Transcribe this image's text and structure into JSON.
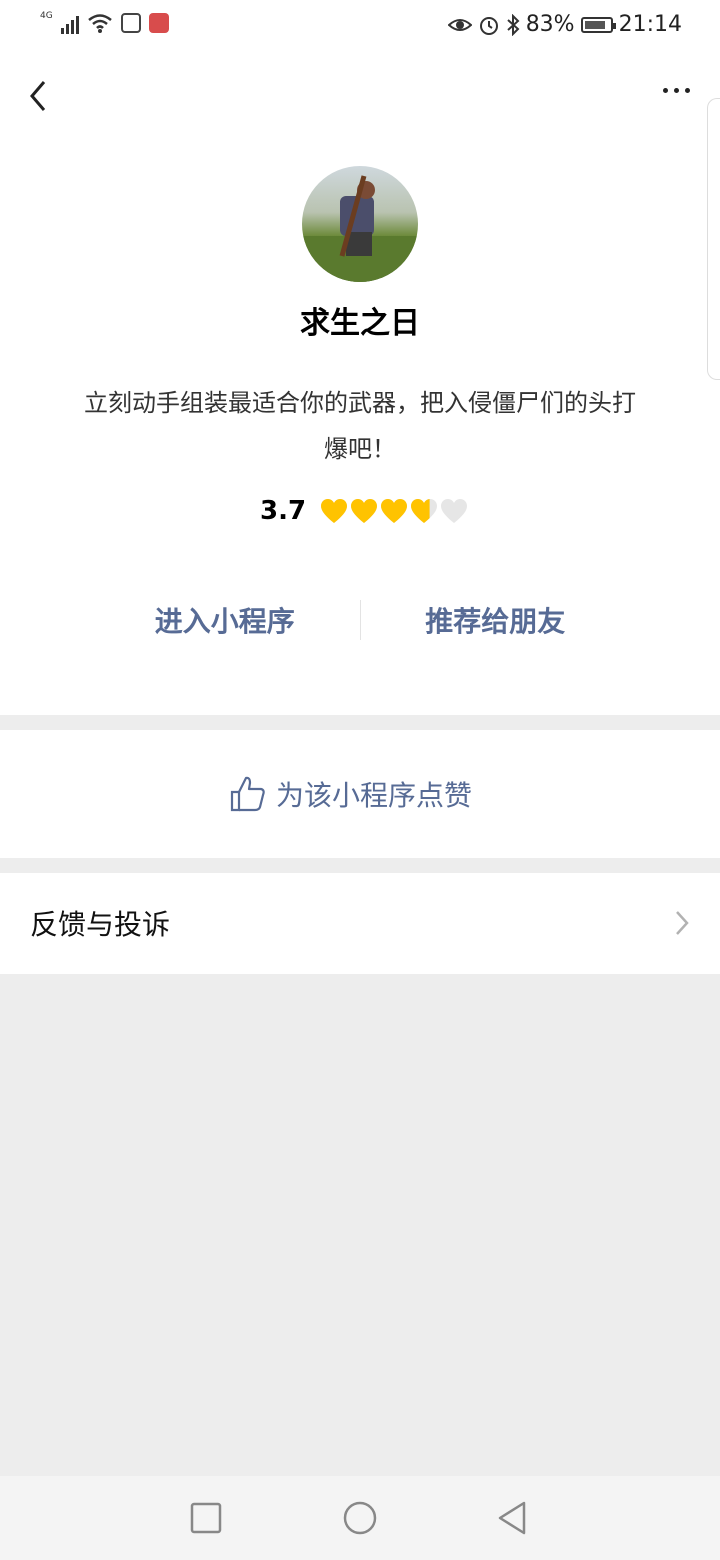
{
  "status_bar": {
    "network_label": "4G",
    "battery_text": "83%",
    "battery_level": 0.83,
    "time": "21:14",
    "icons": [
      "signal-icon",
      "wifi-icon",
      "face-app-icon",
      "red-app-icon",
      "eye-icon",
      "alarm-icon",
      "bluetooth-icon",
      "battery-icon"
    ]
  },
  "header": {
    "back_icon": "chevron-left-icon",
    "more_icon": "more-dots-icon"
  },
  "app": {
    "name": "求生之日",
    "description": "立刻动手组装最适合你的武器，把入侵僵尸们的头打爆吧！",
    "rating_value": "3.7",
    "rating": 3.7,
    "rating_max": 5,
    "accent_color": "#576b95",
    "heart_color": "#ffc300"
  },
  "actions": {
    "enter_label": "进入小程序",
    "share_label": "推荐给朋友"
  },
  "like": {
    "label": "为该小程序点赞",
    "icon": "thumbs-up-icon"
  },
  "feedback": {
    "label": "反馈与投诉",
    "icon": "chevron-right-icon"
  },
  "system_nav": {
    "icons": [
      "recent-apps-icon",
      "home-icon",
      "back-triangle-icon"
    ]
  }
}
